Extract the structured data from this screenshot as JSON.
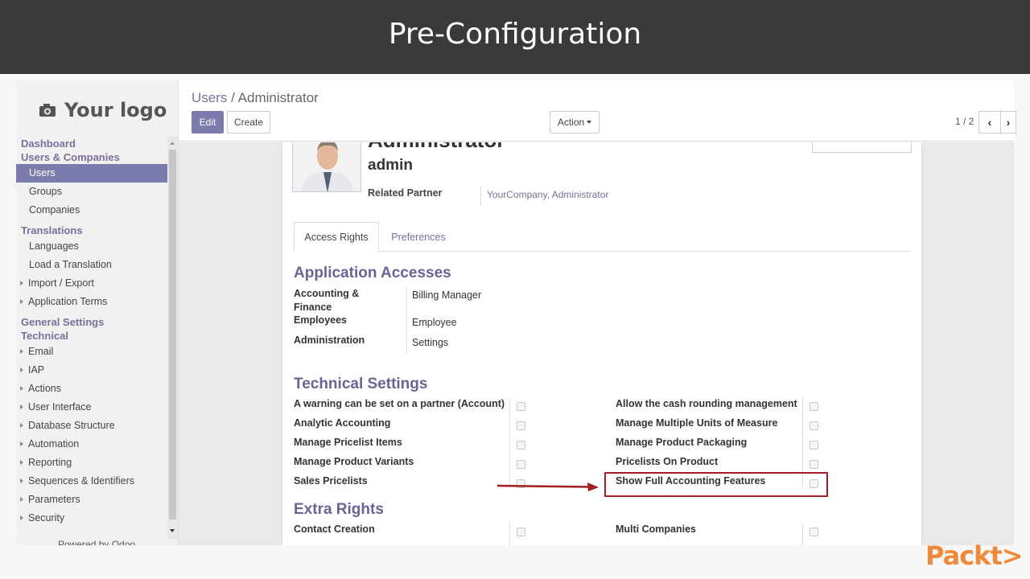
{
  "slide": {
    "title": "Pre-Configuration"
  },
  "sidebar": {
    "logo_text": "Your logo",
    "sections": [
      {
        "label": "Dashboard"
      },
      {
        "label": "Users & Companies"
      },
      {
        "label": "Translations"
      },
      {
        "label": "General Settings"
      },
      {
        "label": "Technical"
      }
    ],
    "items": [
      {
        "label": "Users"
      },
      {
        "label": "Groups"
      },
      {
        "label": "Companies"
      },
      {
        "label": "Languages"
      },
      {
        "label": "Load a Translation"
      },
      {
        "label": "Import / Export"
      },
      {
        "label": "Application Terms"
      },
      {
        "label": "Email"
      },
      {
        "label": "IAP"
      },
      {
        "label": "Actions"
      },
      {
        "label": "User Interface"
      },
      {
        "label": "Database Structure"
      },
      {
        "label": "Automation"
      },
      {
        "label": "Reporting"
      },
      {
        "label": "Sequences & Identifiers"
      },
      {
        "label": "Parameters"
      },
      {
        "label": "Security"
      }
    ],
    "powered_by": "Powered by Odoo"
  },
  "header": {
    "breadcrumb_link": "Users",
    "breadcrumb_sep": "/",
    "breadcrumb_current": "Administrator",
    "edit_label": "Edit",
    "create_label": "Create",
    "action_label": "Action",
    "pager": "1 / 2",
    "prev_icon": "chevron-left-icon",
    "next_icon": "chevron-right-icon"
  },
  "form": {
    "name": "Administrator",
    "login": "admin",
    "related_partner_label": "Related Partner",
    "related_partner_value": "YourCompany, Administrator",
    "tabs": [
      {
        "label": "Access Rights"
      },
      {
        "label": "Preferences"
      }
    ],
    "app_accesses_title": "Application Accesses",
    "app_accesses": [
      {
        "label": "Accounting & Finance",
        "value": "Billing Manager"
      },
      {
        "label": "Employees",
        "value": "Employee"
      },
      {
        "label": "Administration",
        "value": "Settings"
      }
    ],
    "technical_title": "Technical Settings",
    "technical_left": [
      {
        "label": "A warning can be set on a partner (Account)",
        "checked": false
      },
      {
        "label": "Analytic Accounting",
        "checked": false
      },
      {
        "label": "Manage Pricelist Items",
        "checked": false
      },
      {
        "label": "Manage Product Variants",
        "checked": false
      },
      {
        "label": "Sales Pricelists",
        "checked": false
      }
    ],
    "technical_right": [
      {
        "label": "Allow the cash rounding management",
        "checked": false
      },
      {
        "label": "Manage Multiple Units of Measure",
        "checked": false
      },
      {
        "label": "Manage Product Packaging",
        "checked": false
      },
      {
        "label": "Pricelists On Product",
        "checked": false
      },
      {
        "label": "Show Full Accounting Features",
        "checked": false
      }
    ],
    "extra_title": "Extra Rights",
    "extra_left": [
      {
        "label": "Contact Creation",
        "checked": false
      }
    ],
    "extra_right": [
      {
        "label": "Multi Companies",
        "checked": false
      }
    ]
  },
  "branding": {
    "packt": "Packt>"
  },
  "colors": {
    "accent": "#7c7bad",
    "highlight": "#a51c24",
    "packt": "#f08a3b"
  }
}
